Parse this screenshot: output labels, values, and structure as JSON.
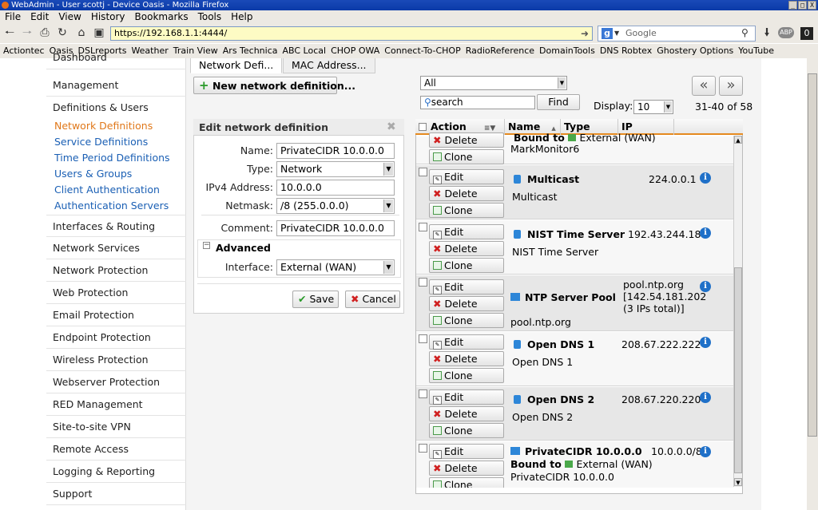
{
  "window": {
    "title": "WebAdmin - User scottj - Device Oasis - Mozilla Firefox",
    "buttons": [
      "_",
      "□",
      "X"
    ]
  },
  "menu": [
    "File",
    "Edit",
    "View",
    "History",
    "Bookmarks",
    "Tools",
    "Help"
  ],
  "nav": {
    "url": "https://192.168.1.1:4444/",
    "search_placeholder": "Google"
  },
  "bookmarks": [
    "Actiontec",
    "Oasis",
    "DSLreports",
    "Weather",
    "Train View",
    "Ars Technica",
    "ABC Local",
    "CHOP OWA",
    "Connect-To-CHOP",
    "RadioReference",
    "DomainTools",
    "DNS Robtex",
    "Ghostery Options",
    "YouTube"
  ],
  "sidebar": {
    "top_partial": "Dashboard",
    "items": [
      "Management",
      "Definitions & Users",
      "Interfaces & Routing",
      "Network Services",
      "Network Protection",
      "Web Protection",
      "Email Protection",
      "Endpoint Protection",
      "Wireless Protection",
      "Webserver Protection",
      "RED Management",
      "Site-to-site VPN",
      "Remote Access",
      "Logging & Reporting",
      "Support"
    ],
    "subitems": [
      "Network Definitions",
      "Service Definitions",
      "Time Period Definitions",
      "Users & Groups",
      "Client Authentication",
      "Authentication Servers"
    ]
  },
  "tabs": [
    "Network Defi...",
    "MAC Address..."
  ],
  "new_button": "New network definition...",
  "edit": {
    "title": "Edit network definition",
    "name_label": "Name:",
    "name": "PrivateCIDR 10.0.0.0",
    "type_label": "Type:",
    "type": "Network",
    "ipv4_label": "IPv4 Address:",
    "ipv4": "10.0.0.0",
    "netmask_label": "Netmask:",
    "netmask": "/8 (255.0.0.0)",
    "comment_label": "Comment:",
    "comment": "PrivateCIDR 10.0.0.0",
    "advanced": "Advanced",
    "interface_label": "Interface:",
    "interface": "External (WAN)",
    "save": "Save",
    "cancel": "Cancel"
  },
  "filter": {
    "type": "All",
    "search": "search",
    "find": "Find",
    "display_label": "Display:",
    "display": "10",
    "range": "31-40 of 58"
  },
  "list": {
    "headers": {
      "action": "Action",
      "name": "Name",
      "type": "Type",
      "ip": "IP"
    },
    "actions": {
      "edit": "Edit",
      "delete": "Delete",
      "clone": "Clone"
    },
    "first_partial": {
      "bound": "Bound to",
      "iface": "External (WAN)",
      "comment": "MarkMonitor6"
    },
    "rows": [
      {
        "name": "Multicast",
        "ip": "224.0.0.1",
        "comment": "Multicast"
      },
      {
        "name": "NIST Time Server",
        "ip": "192.43.244.18",
        "comment": "NIST Time Server"
      },
      {
        "name": "NTP Server Pool",
        "ip1": "pool.ntp.org",
        "ip2": "[142.54.181.202",
        "ip3": "(3 IPs total)]",
        "comment": "pool.ntp.org"
      },
      {
        "name": "Open DNS 1",
        "ip": "208.67.222.222",
        "comment": "Open DNS 1"
      },
      {
        "name": "Open DNS 2",
        "ip": "208.67.220.220",
        "comment": "Open DNS 2"
      },
      {
        "name": "PrivateCIDR 10.0.0.0",
        "ip": "10.0.0.0/8",
        "bound": "Bound to",
        "iface": "External (WAN)",
        "comment": "PrivateCIDR 10.0.0.0"
      }
    ]
  }
}
